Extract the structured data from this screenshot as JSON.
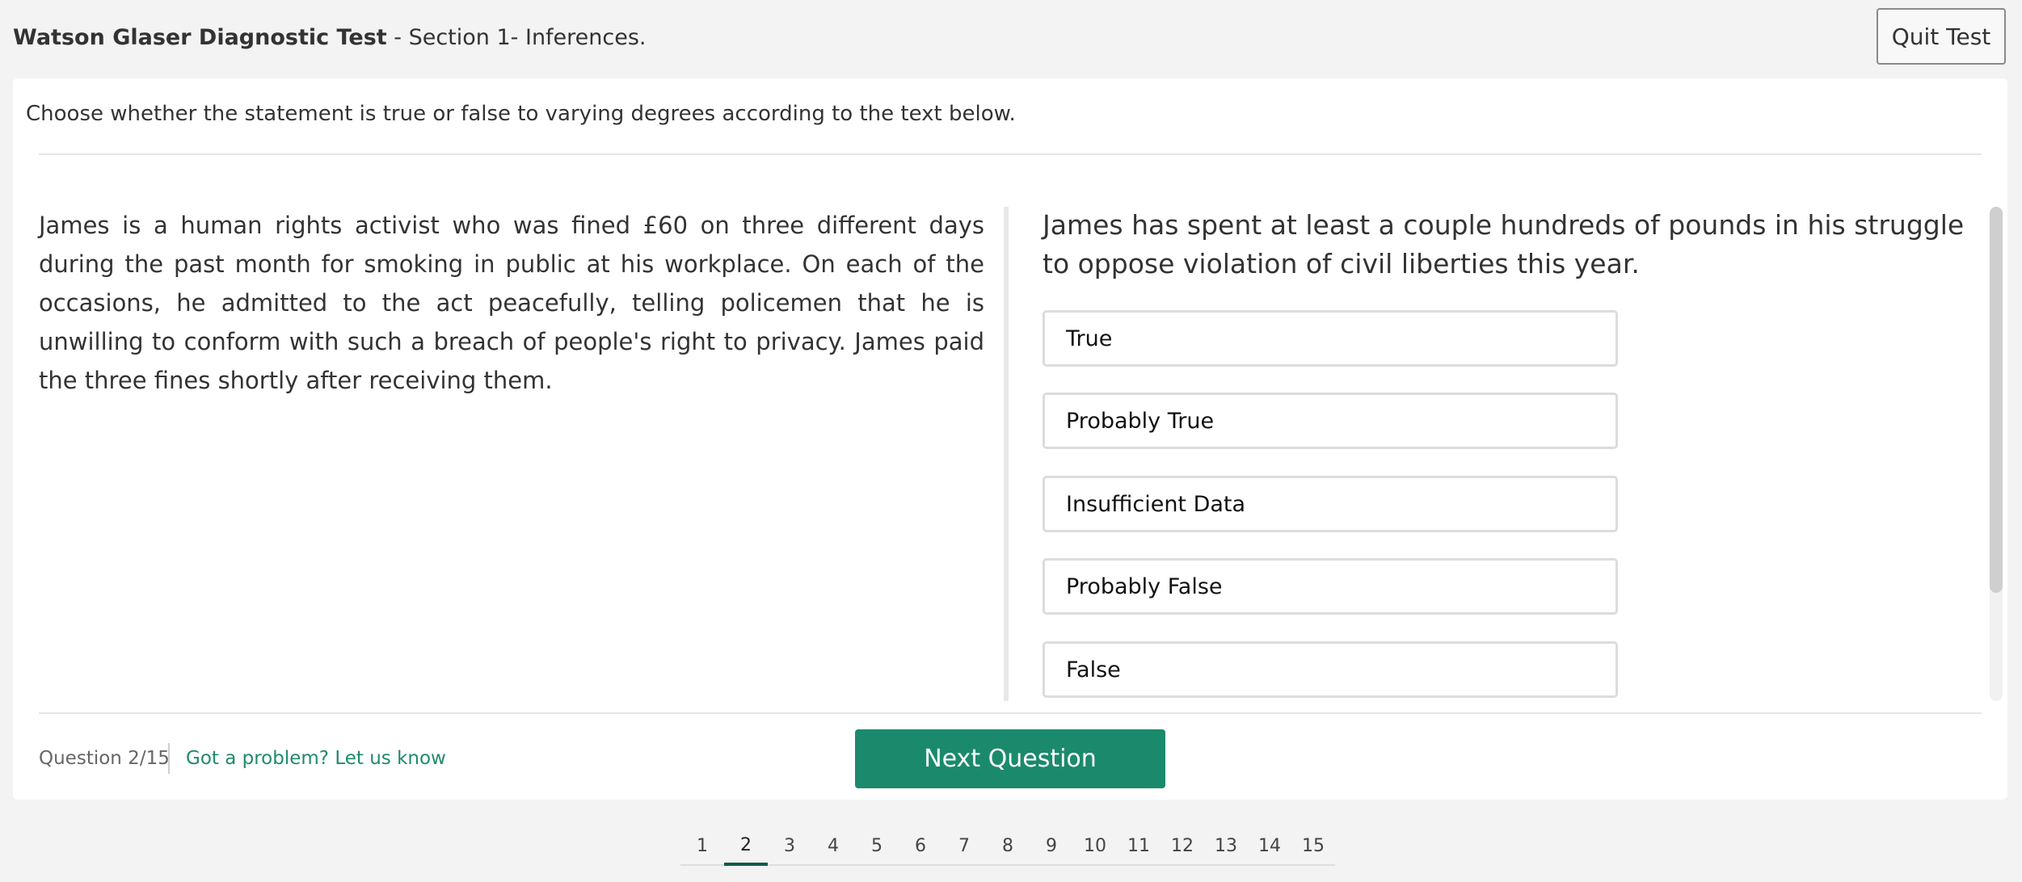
{
  "header": {
    "test_name": "Watson Glaser Diagnostic Test",
    "section": " - Section 1- Inferences.",
    "quit_label": "Quit Test"
  },
  "instruction": "Choose whether the statement is true or false to varying degrees according to the text below.",
  "passage": "James is a human rights activist who was fined £60 on three different days during the past month for smoking in public at his workplace. On each of the occasions, he admitted to the act peacefully, telling policemen that he is unwilling to conform with such a breach of people's right to privacy. James paid the three fines shortly after receiving them.",
  "statement": "James has spent at least a couple hundreds of pounds in his struggle to oppose violation of civil liberties this year.",
  "options": [
    "True",
    "Probably True",
    "Insufficient Data",
    "Probably False",
    "False"
  ],
  "footer": {
    "question_counter": "Question 2/15",
    "problem_link": "Got a problem? Let us know",
    "next_label": "Next Question"
  },
  "pagination": {
    "pages": [
      "1",
      "2",
      "3",
      "4",
      "5",
      "6",
      "7",
      "8",
      "9",
      "10",
      "11",
      "12",
      "13",
      "14",
      "15"
    ],
    "current": "2"
  },
  "colors": {
    "accent": "#1b8a6c",
    "link": "#1f8a6d",
    "active_page_underline": "#0f5a48"
  }
}
